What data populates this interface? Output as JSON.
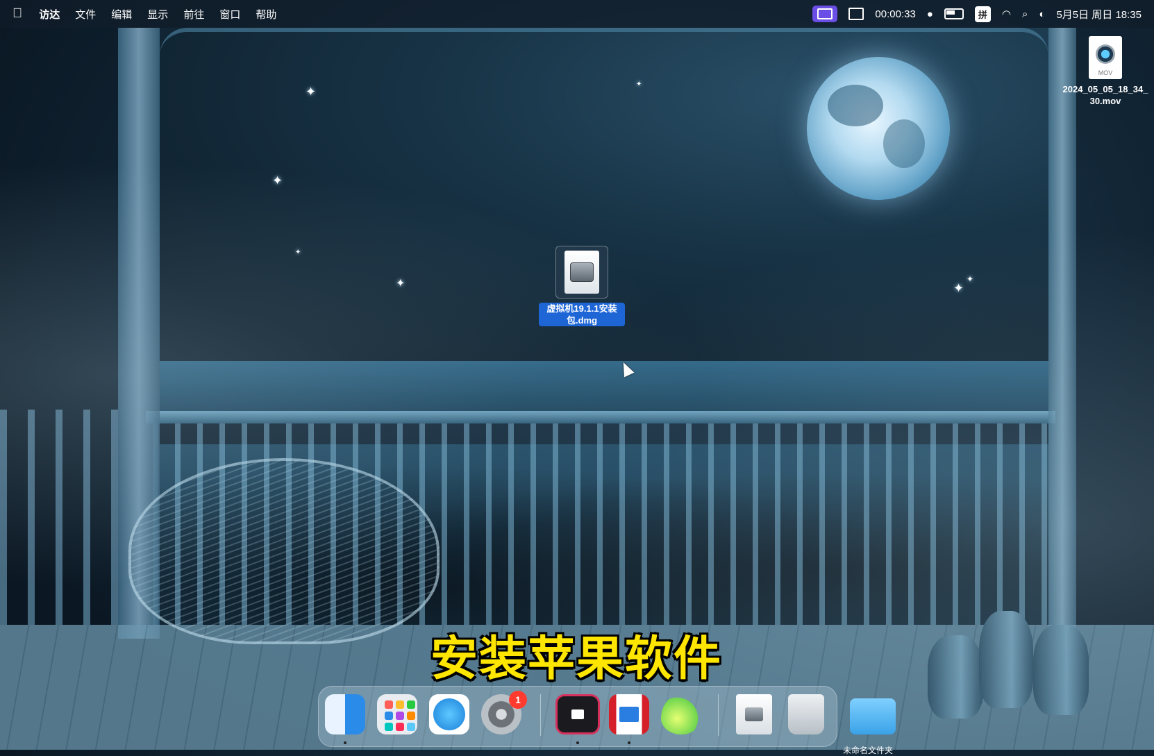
{
  "menubar": {
    "apple_icon": "apple-logo-icon",
    "items": [
      "访达",
      "文件",
      "编辑",
      "显示",
      "前往",
      "窗口",
      "帮助"
    ],
    "timer": "00:00:33",
    "input_method": "拼",
    "datetime": "5月5日 周日 18:35",
    "accent": "#6b4ee6"
  },
  "desktop": {
    "dmg_file": {
      "name": "虚拟机19.1.1安装包.dmg",
      "selected": true
    },
    "mov_file": {
      "name": "2024_05_05_18_34_30.mov",
      "badge": "MOV"
    }
  },
  "subtitle": "安装苹果软件",
  "dock": {
    "items": [
      {
        "name": "访达",
        "icon": "finder-icon",
        "running": true
      },
      {
        "name": "启动台",
        "icon": "launchpad-icon",
        "running": false
      },
      {
        "name": "Safari浏览器",
        "icon": "safari-icon",
        "running": false
      },
      {
        "name": "系统设置",
        "icon": "settings-icon",
        "running": false,
        "badge": "1"
      },
      {
        "name": "录屏",
        "icon": "screen-recorder-icon",
        "running": true
      },
      {
        "name": "Parallels Desktop",
        "icon": "parallels-icon",
        "running": true
      },
      {
        "name": "叶子应用",
        "icon": "leaf-app-icon",
        "running": false
      },
      {
        "name": "虚拟机19.1.1安装包.dmg",
        "icon": "dmg-file-icon",
        "running": false
      },
      {
        "name": "废纸篓",
        "icon": "trash-icon",
        "running": false
      }
    ],
    "folder_label": "未命名文件夹"
  }
}
